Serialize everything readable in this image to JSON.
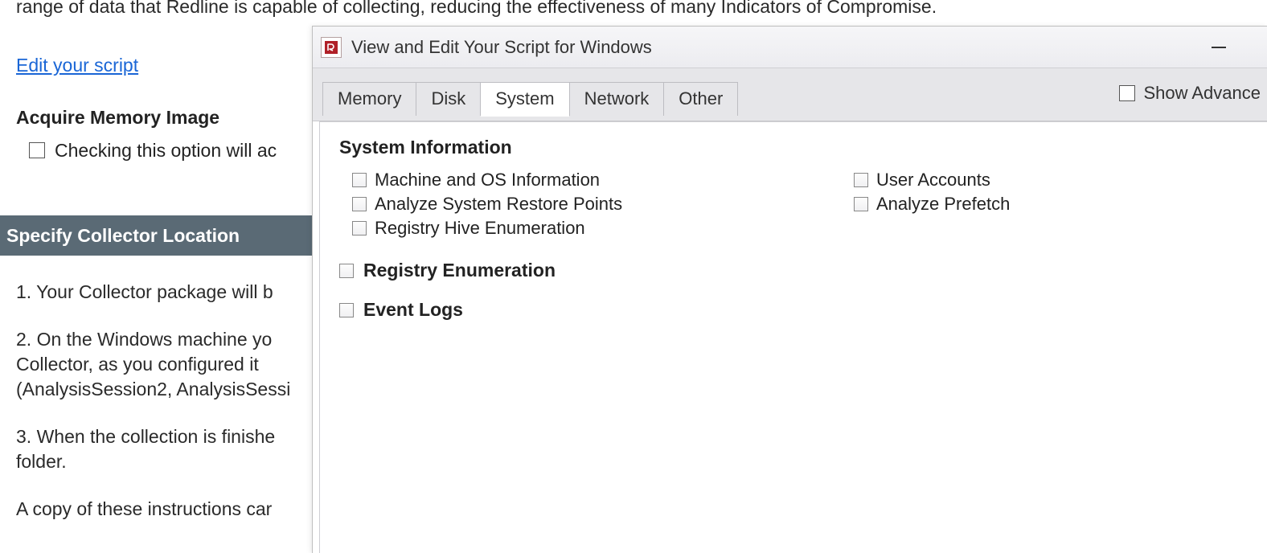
{
  "background": {
    "intro_text": "range of data that Redline is capable of collecting, reducing the effectiveness of many Indicators of Compromise.",
    "edit_link": "Edit your script",
    "acquire_heading": "Acquire Memory Image",
    "acquire_checkbox_label": "Checking this option will ac",
    "acquire_checked": true,
    "section_bar": "Specify Collector Location",
    "step1": "1. Your Collector package will b",
    "step2a": "2. On the Windows machine yo",
    "step2b": "Collector, as you configured it",
    "step2c": "(AnalysisSession2, AnalysisSessi",
    "step3a": "3. When the collection is finishe",
    "step3b": "folder.",
    "copy_note": "A copy of these instructions car"
  },
  "dialog": {
    "title": "View and Edit Your Script for Windows",
    "tabs": [
      "Memory",
      "Disk",
      "System",
      "Network",
      "Other"
    ],
    "active_tab_index": 2,
    "show_advanced_label": "Show Advance",
    "show_advanced_checked": false,
    "system_tab": {
      "group_title": "System Information",
      "left_items": [
        {
          "label": "Machine and OS Information",
          "checked": true
        },
        {
          "label": "Analyze System Restore Points",
          "checked": false
        },
        {
          "label": "Registry Hive Enumeration",
          "checked": true
        }
      ],
      "right_items": [
        {
          "label": "User Accounts",
          "checked": true
        },
        {
          "label": "Analyze Prefetch",
          "checked": true
        }
      ],
      "registry_enum": {
        "label": "Registry Enumeration",
        "checked": false
      },
      "event_logs": {
        "label": "Event Logs",
        "checked": false
      }
    }
  }
}
